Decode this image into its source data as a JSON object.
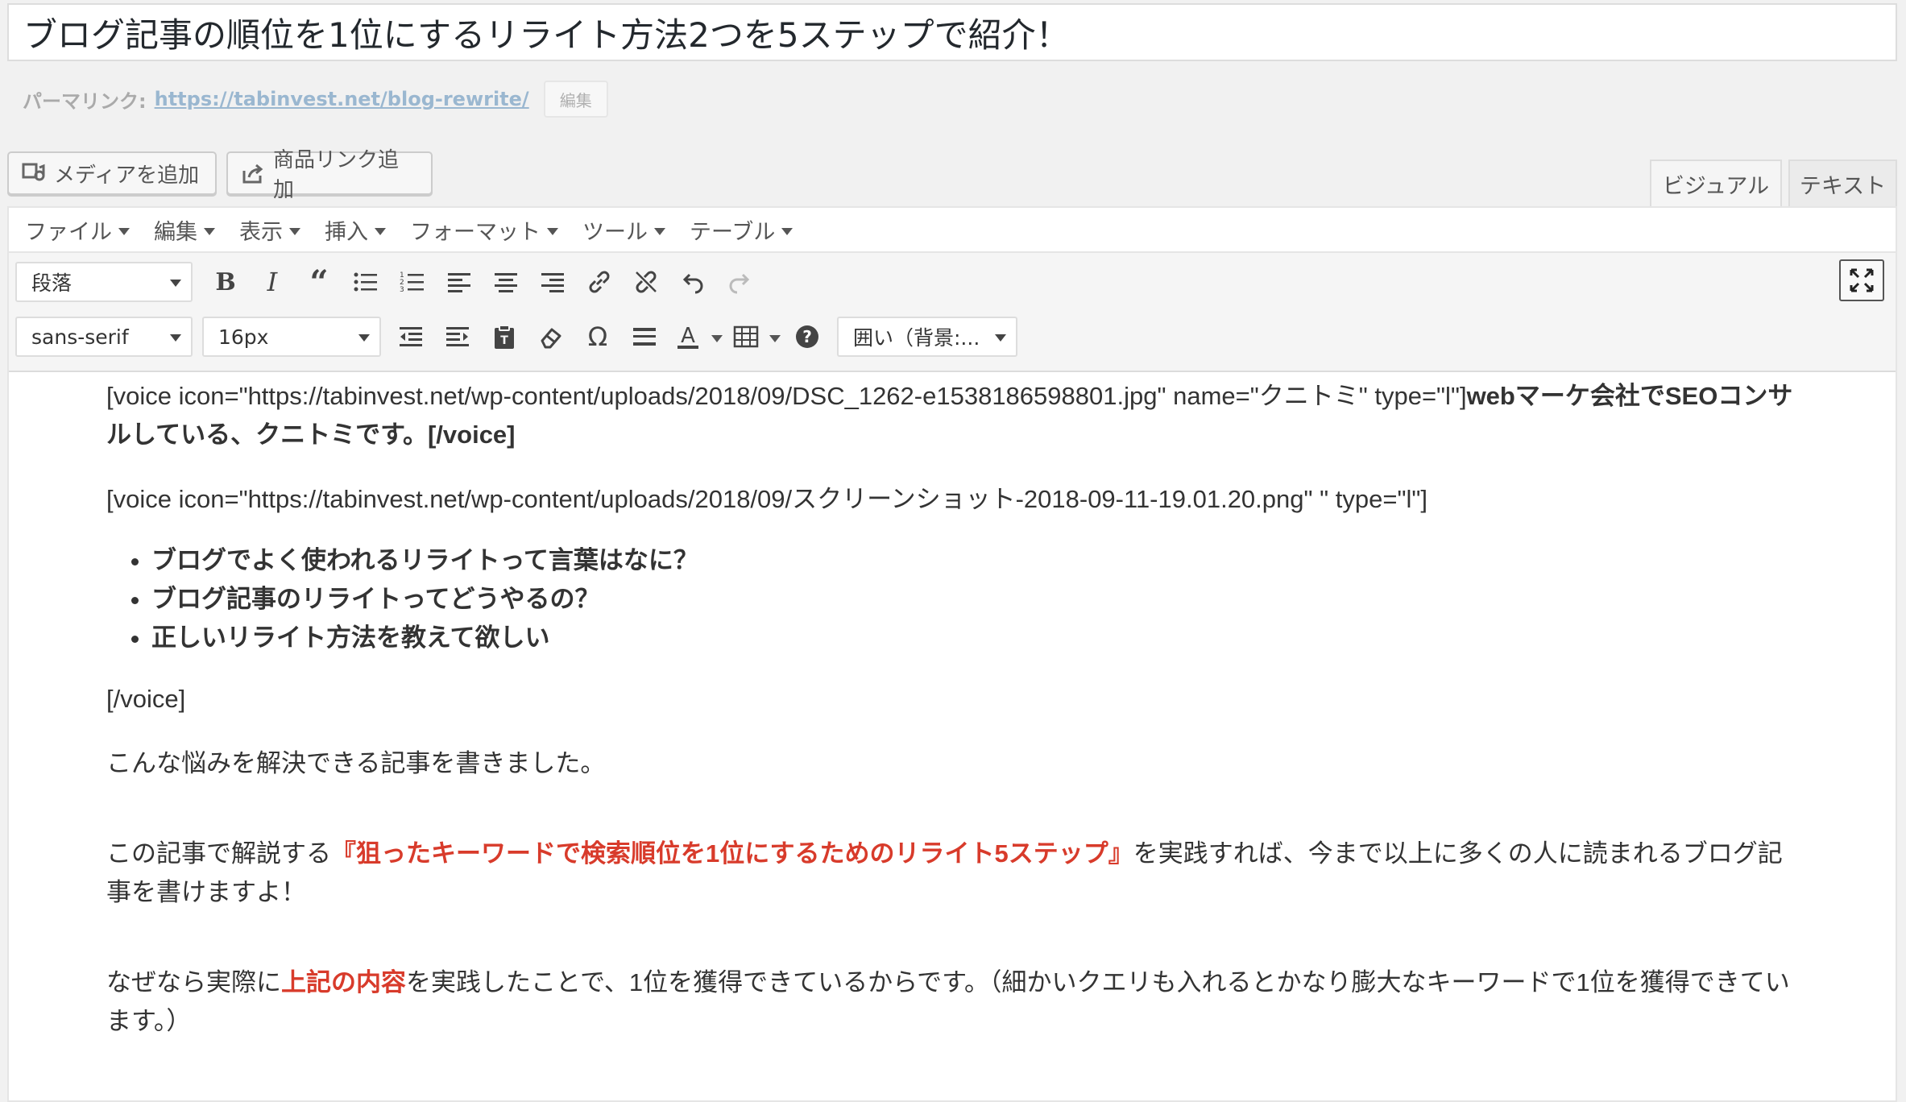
{
  "title": "ブログ記事の順位を1位にするリライト方法2つを5ステップで紹介！",
  "permalink": {
    "label": "パーマリンク:",
    "url": "https://tabinvest.net/blog-rewrite/",
    "edit_label": "編集"
  },
  "media_buttons": {
    "add_media": "メディアを追加",
    "add_product_link": "商品リンク追加"
  },
  "tabs": {
    "visual": "ビジュアル",
    "text": "テキスト"
  },
  "menubar": [
    {
      "label": "ファイル"
    },
    {
      "label": "編集"
    },
    {
      "label": "表示"
    },
    {
      "label": "挿入"
    },
    {
      "label": "フォーマット"
    },
    {
      "label": "ツール"
    },
    {
      "label": "テーブル"
    }
  ],
  "toolbar": {
    "paragraph_format": "段落",
    "font_family": "sans-serif",
    "font_size": "16px",
    "box_style": "囲い（背景:..."
  },
  "content": {
    "voice1_prefix": "[voice icon=\"https://tabinvest.net/wp-content/uploads/2018/09/DSC_1262-e1538186598801.jpg\" name=\"クニトミ\" type=\"l\"]",
    "voice1_bold": "webマーケ会社でSEOコンサルしている、クニトミです。[/voice]",
    "voice2": "[voice icon=\"https://tabinvest.net/wp-content/uploads/2018/09/スクリーンショット-2018-09-11-19.01.20.png\" \" type=\"l\"]",
    "list": [
      "ブログでよく使われるリライトって言葉はなに？",
      "ブログ記事のリライトってどうやるの？",
      "正しいリライト方法を教えて欲しい"
    ],
    "voice_close": "[/voice]",
    "p1": "こんな悩みを解決できる記事を書きました。",
    "p2_pre": "この記事で解説する",
    "p2_red": "『狙ったキーワードで検索順位を1位にするためのリライト5ステップ』",
    "p2_post": "を実践すれば、今まで以上に多くの人に読まれるブログ記事を書けますよ！",
    "p3_pre": "なぜなら実際に",
    "p3_red": "上記の内容",
    "p3_post": "を実践したことで、1位を獲得できているからです。（細かいクエリも入れるとかなり膨大なキーワードで1位を獲得できています。）"
  }
}
